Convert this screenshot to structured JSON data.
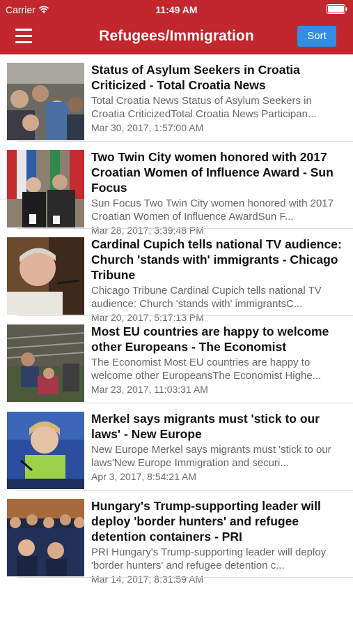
{
  "status_bar": {
    "carrier": "Carrier",
    "time": "11:49 AM"
  },
  "nav": {
    "title": "Refugees/Immigration",
    "sort_label": "Sort",
    "menu_icon": "hamburger-menu-icon"
  },
  "colors": {
    "nav_background": "#c1272d",
    "sort_button": "#2f8fe6"
  },
  "articles": [
    {
      "headline": "Status of Asylum Seekers in Croatia Criticized - Total Croatia News",
      "summary": "Total Croatia News    Status of Asylum Seekers in Croatia CriticizedTotal Croatia News  Participan...",
      "date": "Mar 30, 2017, 1:57:00 AM"
    },
    {
      "headline": "Two Twin City women honored with 2017 Croatian Women of Influence Award - Sun Focus",
      "summary": "Sun Focus    Two Twin City women honored with 2017 Croatian Women of Influence AwardSun F...",
      "date": "Mar 28, 2017, 3:39:48 PM"
    },
    {
      "headline": "Cardinal Cupich tells national TV audience: Church 'stands with' immigrants - Chicago Tribune",
      "summary": "Chicago Tribune    Cardinal Cupich tells national TV audience: Church 'stands with' immigrantsC...",
      "date": "Mar 20, 2017, 5:17:13 PM"
    },
    {
      "headline": "Most EU countries are happy to welcome other Europeans - The Economist",
      "summary": "The Economist    Most EU countries are happy to welcome other EuropeansThe Economist  Highe...",
      "date": "Mar 23, 2017, 11:03:31 AM"
    },
    {
      "headline": "Merkel says migrants must 'stick to our laws' - New Europe",
      "summary": "New Europe    Merkel says migrants must 'stick to our laws'New Europe  Immigration and securi...",
      "date": "Apr 3, 2017, 8:54:21 AM"
    },
    {
      "headline": "Hungary's Trump-supporting leader will deploy 'border hunters' and refugee detention containers - PRI",
      "summary": "PRI    Hungary's Trump-supporting leader will deploy 'border hunters' and refugee detention c...",
      "date": "Mar 14, 2017, 8:31:59 AM"
    }
  ]
}
